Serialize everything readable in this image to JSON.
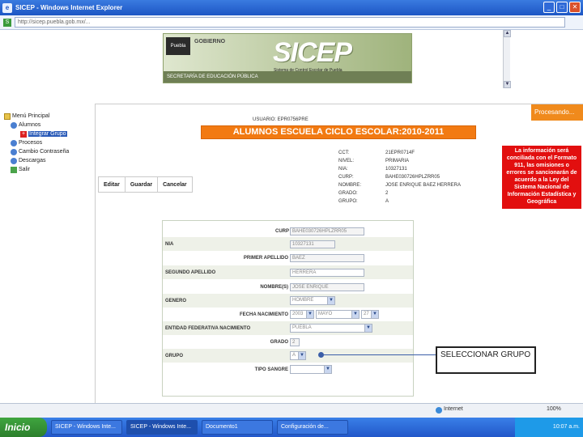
{
  "window": {
    "title": "SICEP - Windows Internet Explorer",
    "url": "http://sicep.puebla.gob.mx/..."
  },
  "banner": {
    "logo_puebla": "Puebla",
    "logo_gob": "GOBIERNO",
    "sicep": "SICEP",
    "sicep_sub": "Sistema de Control Escolar de Puebla",
    "secretaria": "SECRETARÍA DE EDUCACIÓN PÚBLICA"
  },
  "menu": {
    "items": [
      {
        "label": "Menú Principal"
      },
      {
        "label": "Alumnos"
      },
      {
        "label": "Integrar Grupo"
      },
      {
        "label": "Procesos"
      },
      {
        "label": "Cambio Contraseña"
      },
      {
        "label": "Descargas"
      },
      {
        "label": "Salir"
      }
    ]
  },
  "header": {
    "usuario": "USUARIO: EPR0756PRE",
    "procesando": "Procesando...",
    "title": "ALUMNOS ESCUELA CICLO ESCOLAR:2010-2011"
  },
  "info": {
    "rows": [
      {
        "k": "CCT:",
        "v": "21EPR0714F"
      },
      {
        "k": "NIVEL:",
        "v": "PRIMARIA"
      },
      {
        "k": "NIA:",
        "v": "10327131"
      },
      {
        "k": "CURP:",
        "v": "BAHE030726HPLZRR05"
      },
      {
        "k": "NOMBRE:",
        "v": "JOSE ENRIQUE BAEZ HERRERA"
      },
      {
        "k": "GRADO:",
        "v": "2"
      },
      {
        "k": "GRUPO:",
        "v": "A"
      }
    ]
  },
  "warning": "La información será conciliada con el Formato 911, las omisiones o errores se sancionarán de acuerdo a la Ley del Sistema Nacional de Información Estadística y Geográfica",
  "toolbar": {
    "editar": "Editar",
    "guardar": "Guardar",
    "cancelar": "Cancelar"
  },
  "form": {
    "curp_label": "CURP",
    "curp_value": "BAHE030726HPLZRR05",
    "nia_label": "NIA",
    "nia_value": "10327131",
    "primer_label": "PRIMER APELLIDO",
    "primer_value": "BAEZ",
    "segundo_label": "SEGUNDO APELLIDO",
    "segundo_value": "HERRERA",
    "nombre_label": "NOMBRE(S)",
    "nombre_value": "JOSE ENRIQUE",
    "genero_label": "GENERO",
    "genero_value": "HOMBRE",
    "fecha_label": "FECHA NACIMIENTO",
    "fecha_anio": "2003",
    "fecha_mes": "MAYO",
    "fecha_dia": "27",
    "entidad_label": "ENTIDAD FEDERATIVA NACIMIENTO",
    "entidad_value": "PUEBLA",
    "grado_label": "GRADO",
    "grado_value": "2",
    "grupo_label": "GRUPO",
    "grupo_value": "A",
    "sangre_label": "TIPO SANGRE",
    "sangre_value": ""
  },
  "callout": "SELECCIONAR GRUPO",
  "statusbar": {
    "zone": "Internet",
    "zoom": "100%"
  },
  "taskbar": {
    "start": "Inicio",
    "tasks": [
      "SICEP - Windows Inte...",
      "SICEP - Windows Inte...",
      "Documento1",
      "Configuración de..."
    ],
    "clock": "10:07 a.m."
  }
}
